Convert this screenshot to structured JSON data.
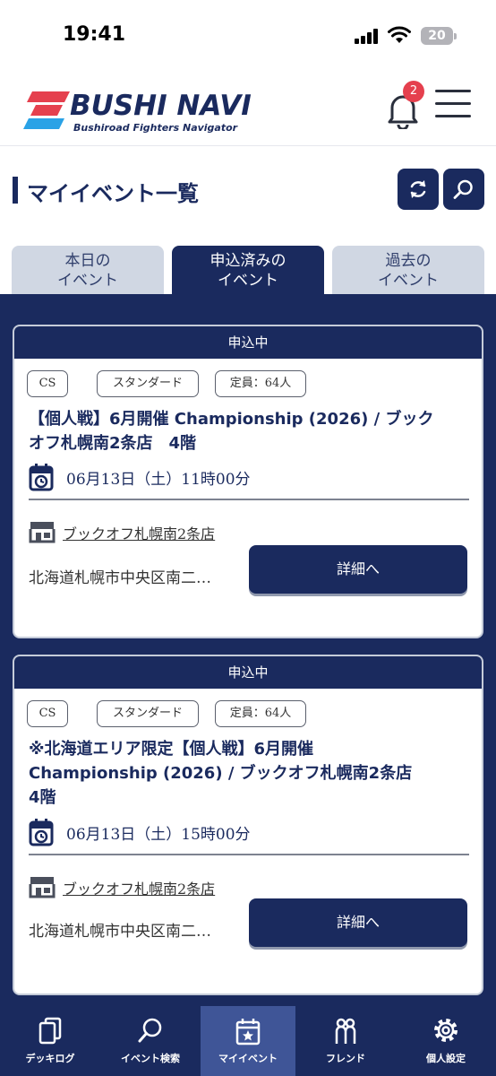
{
  "status_bar": {
    "time": "19:41",
    "battery": "20"
  },
  "header": {
    "logo_text": "BUSHI NAVI",
    "logo_subtitle": "Bushiroad Fighters Navigator",
    "notification_count": "2",
    "icons": [
      "bell-icon",
      "hamburger-menu-icon"
    ]
  },
  "page": {
    "title": "マイイベント一覧",
    "actions": [
      "refresh-icon",
      "search-icon"
    ]
  },
  "tabs": [
    {
      "line1": "本日の",
      "line2": "イベント",
      "active": false
    },
    {
      "line1": "申込済みの",
      "line2": "イベント",
      "active": true
    },
    {
      "line1": "過去の",
      "line2": "イベント",
      "active": false
    }
  ],
  "events": [
    {
      "status": "申込中",
      "tags": [
        "CS",
        "スタンダード",
        "定員：64人"
      ],
      "title_line1": "【個人戦】6月開催 Championship (2026) / ブック",
      "title_line2": "オフ札幌南2条店　4階",
      "title_line3": "",
      "datetime": "06月13日（土）11時00分",
      "store": "ブックオフ札幌南2条店",
      "address": "北海道札幌市中央区南二…",
      "button": "詳細へ"
    },
    {
      "status": "申込中",
      "tags": [
        "CS",
        "スタンダード",
        "定員：64人"
      ],
      "title_line1": "※北海道エリア限定【個人戦】6月開催",
      "title_line2": "Championship (2026) / ブックオフ札幌南2条店",
      "title_line3": "4階",
      "datetime": "06月13日（土）15時00分",
      "store": "ブックオフ札幌南2条店",
      "address": "北海道札幌市中央区南二…",
      "button": "詳細へ"
    }
  ],
  "bottom_nav": [
    {
      "label": "デッキログ",
      "icon": "deck-cards-icon",
      "active": false
    },
    {
      "label": "イベント検索",
      "icon": "search-icon",
      "active": false
    },
    {
      "label": "マイイベント",
      "icon": "calendar-star-icon",
      "active": true
    },
    {
      "label": "フレンド",
      "icon": "friends-icon",
      "active": false
    },
    {
      "label": "個人設定",
      "icon": "gear-icon",
      "active": false
    }
  ],
  "colors": {
    "primary": "#1a2a5e",
    "accent_red": "#e5404e",
    "logo_blue": "#2aa2e6",
    "tab_inactive": "#d0d7e3",
    "nav_active": "#3f5597"
  }
}
